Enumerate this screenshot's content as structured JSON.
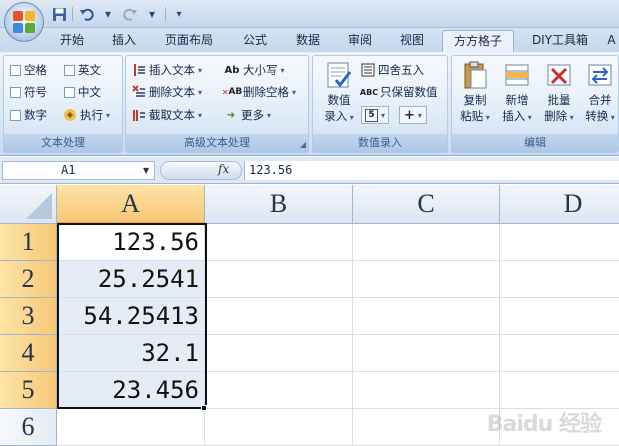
{
  "colors": {
    "accent": "#f8c777",
    "ribbon": "#dbe8f6",
    "tab_active": "#eaf1fa"
  },
  "qat": {
    "icons": [
      "save-icon",
      "undo-icon",
      "redo-icon",
      "customize-icon"
    ]
  },
  "tabs": [
    "开始",
    "插入",
    "页面布局",
    "公式",
    "数据",
    "审阅",
    "视图",
    "方方格子",
    "DIY工具箱",
    "A"
  ],
  "active_tab": "方方格子",
  "ribbon": {
    "text_group": {
      "label": "文本处理",
      "space": "空格",
      "english": "英文",
      "symbol": "符号",
      "chinese": "中文",
      "number": "数字",
      "execute": "执行"
    },
    "adv_group": {
      "label": "高级文本处理",
      "insert_text": "插入文本",
      "case": "大小写",
      "delete_text": "删除文本",
      "delete_space": "删除空格",
      "extract_text": "截取文本",
      "more": "更多"
    },
    "entry_group": {
      "label": "数值录入",
      "value_entry_line1": "数值",
      "value_entry_line2": "录入",
      "round": "四舍五入",
      "keep_values": "只保留数值",
      "small_btn": "5",
      "plus_btn": "+"
    },
    "edit_group": {
      "label": "编辑",
      "copy_paste_1": "复制",
      "copy_paste_2": "粘贴",
      "new_insert_1": "新增",
      "new_insert_2": "插入",
      "batch_delete_1": "批量",
      "batch_delete_2": "删除",
      "merge_convert_1": "合并",
      "merge_convert_2": "转换"
    }
  },
  "formula": {
    "name_box": "A1",
    "fx": "fx",
    "value": "123.56"
  },
  "sheet": {
    "columns": [
      "A",
      "B",
      "C",
      "D"
    ],
    "rows": [
      "1",
      "2",
      "3",
      "4",
      "5",
      "6"
    ],
    "cells": [
      "123.56",
      "25.2541",
      "54.25413",
      "32.1",
      "23.456",
      ""
    ]
  },
  "watermark": "Baidu 经验"
}
